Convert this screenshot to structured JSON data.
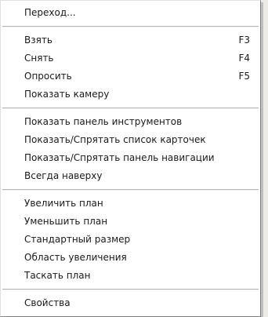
{
  "menu": {
    "groups": [
      [
        {
          "label": "Переход...",
          "shortcut": ""
        }
      ],
      [
        {
          "label": "Взять",
          "shortcut": "F3"
        },
        {
          "label": "Снять",
          "shortcut": "F4"
        },
        {
          "label": "Опросить",
          "shortcut": "F5"
        },
        {
          "label": "Показать камеру",
          "shortcut": ""
        }
      ],
      [
        {
          "label": "Показать панель инструментов",
          "shortcut": ""
        },
        {
          "label": "Показать/Спрятать список карточек",
          "shortcut": ""
        },
        {
          "label": "Показать/Спрятать панель навигации",
          "shortcut": ""
        },
        {
          "label": "Всегда наверху",
          "shortcut": ""
        }
      ],
      [
        {
          "label": "Увеличить план",
          "shortcut": ""
        },
        {
          "label": "Уменьшить план",
          "shortcut": ""
        },
        {
          "label": "Стандартный размер",
          "shortcut": ""
        },
        {
          "label": "Область увеличения",
          "shortcut": ""
        },
        {
          "label": "Таскать план",
          "shortcut": ""
        }
      ],
      [
        {
          "label": "Свойства",
          "shortcut": ""
        }
      ]
    ]
  }
}
